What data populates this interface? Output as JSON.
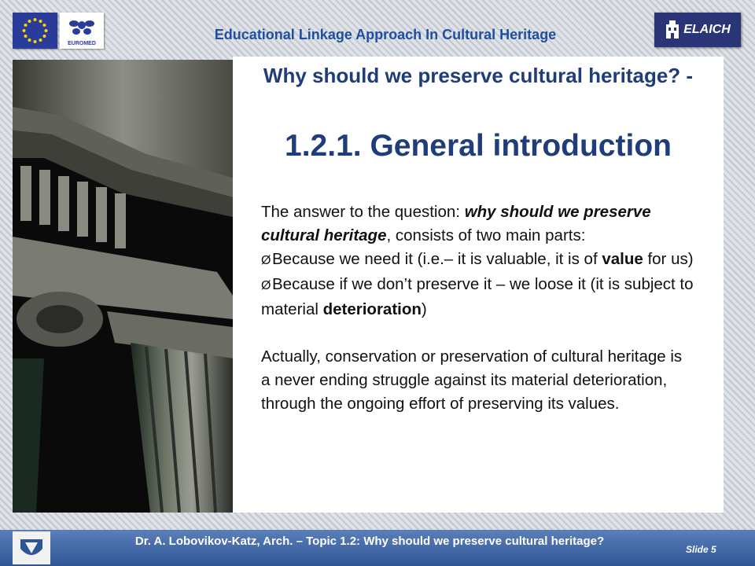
{
  "header": {
    "title": "Educational Linkage Approach In Cultural Heritage",
    "logo_euromed_text": "EUROMED",
    "logo_elaich_text": "ELAICH"
  },
  "slide": {
    "question_title": "Why should we preserve cultural heritage? -",
    "main_title": "1.2.1.  General introduction",
    "intro_a": "The answer to the question: ",
    "intro_b": "why should we preserve cultural heritage",
    "intro_c": ", consists of two main parts:",
    "bullet_marker": "Ø",
    "bullet1_a": "Because we need it (i.e.– it is valuable, it is of ",
    "bullet1_b": "value",
    "bullet1_c": " for us)",
    "bullet2_a": "Because if we don’t preserve it – we loose it (it is subject to material ",
    "bullet2_b": "deterioration",
    "bullet2_c": ")",
    "para2": "Actually, conservation or preservation of cultural heritage is a never ending struggle against its material deterioration, through the ongoing effort of preserving its values."
  },
  "footer": {
    "text": "Dr. A. Lobovikov-Katz, Arch. – Topic 1.2:  Why should we preserve cultural heritage?",
    "slide_label": "Slide 5"
  },
  "colors": {
    "title_blue": "#1f3d7a",
    "header_blue": "#1f4fa0",
    "footer_blue": "#2f5597"
  }
}
